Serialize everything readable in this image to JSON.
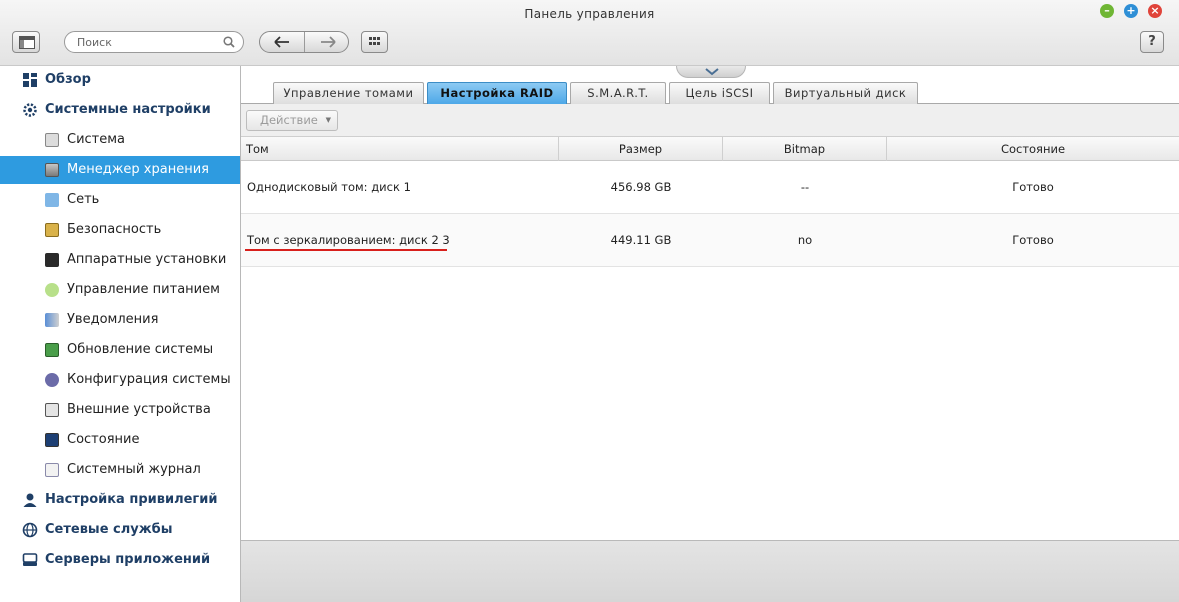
{
  "window": {
    "title": "Панель управления"
  },
  "search": {
    "placeholder": "Поиск"
  },
  "help": {
    "label": "?"
  },
  "sidebar": {
    "items": [
      {
        "label": "Обзор",
        "level": "top",
        "icon": "overview-icon"
      },
      {
        "label": "Системные настройки",
        "level": "top",
        "icon": "gear-icon"
      },
      {
        "label": "Система",
        "level": "sub",
        "icon": "system-icon"
      },
      {
        "label": "Менеджер хранения",
        "level": "sub",
        "icon": "storage-icon",
        "active": true
      },
      {
        "label": "Сеть",
        "level": "sub",
        "icon": "network-icon"
      },
      {
        "label": "Безопасность",
        "level": "sub",
        "icon": "lock-icon"
      },
      {
        "label": "Аппаратные установки",
        "level": "sub",
        "icon": "hardware-icon"
      },
      {
        "label": "Управление питанием",
        "level": "sub",
        "icon": "power-bulb-icon"
      },
      {
        "label": "Уведомления",
        "level": "sub",
        "icon": "notification-icon"
      },
      {
        "label": "Обновление системы",
        "level": "sub",
        "icon": "update-icon"
      },
      {
        "label": "Конфигурация системы",
        "level": "sub",
        "icon": "config-gear-icon"
      },
      {
        "label": "Внешние устройства",
        "level": "sub",
        "icon": "external-device-icon"
      },
      {
        "label": "Состояние",
        "level": "sub",
        "icon": "monitor-icon"
      },
      {
        "label": "Системный журнал",
        "level": "sub",
        "icon": "log-icon"
      },
      {
        "label": "Настройка привилегий",
        "level": "top",
        "icon": "user-icon"
      },
      {
        "label": "Сетевые службы",
        "level": "top",
        "icon": "globe-icon"
      },
      {
        "label": "Серверы приложений",
        "level": "top",
        "icon": "app-server-icon"
      }
    ]
  },
  "tabs": [
    {
      "label": "Управление томами"
    },
    {
      "label": "Настройка RAID",
      "active": true
    },
    {
      "label": "S.M.A.R.T."
    },
    {
      "label": "Цель iSCSI"
    },
    {
      "label": "Виртуальный диск"
    }
  ],
  "toolbar": {
    "action_label": "Действие"
  },
  "table": {
    "columns": [
      "Том",
      "Размер",
      "Bitmap",
      "Состояние"
    ],
    "rows": [
      {
        "name": "Однодисковый том: диск 1",
        "size": "456.98 GB",
        "bitmap": "--",
        "status": "Готово"
      },
      {
        "name": "Том с зеркалированием: диск 2 3",
        "size": "449.11 GB",
        "bitmap": "no",
        "status": "Готово"
      }
    ]
  },
  "colors": {
    "accent": "#2e9be0",
    "tab_active": "#4da8e8",
    "highlight_underline": "#d8201c"
  }
}
